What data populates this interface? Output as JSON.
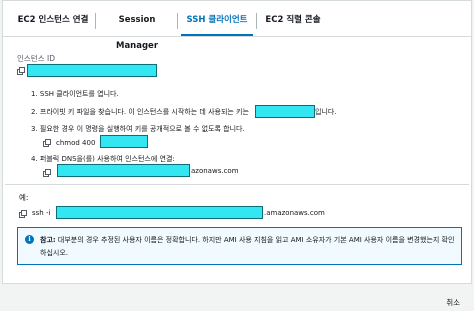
{
  "tabs": [
    {
      "label": "EC2 인스턴스 연결"
    },
    {
      "label": "Session Manager"
    },
    {
      "label": "SSH 클라이언트",
      "active": true
    },
    {
      "label": "EC2 직렬 콘솔"
    }
  ],
  "instance": {
    "label": "인스턴스 ID"
  },
  "steps": [
    {
      "num": "1.",
      "text": "SSH 클라이언트를 엽니다."
    },
    {
      "num": "2.",
      "text": "프라이빗 키 파일을 찾습니다. 이 인스턴스를 시작하는 데 사용되는 키는",
      "suffix": "입니다."
    },
    {
      "num": "3.",
      "text": "필요한 경우 이 명령을 실행하여 키를 공개적으로 볼 수 없도록 합니다."
    },
    {
      "num": "4.",
      "text": "퍼블릭 DNS을(를) 사용하여 인스턴스에 연결:"
    }
  ],
  "chmod_cmd": "chmod 400",
  "dns_suffix": "azonaws.com",
  "example": {
    "label": "예:",
    "cmd_prefix": "ssh -i",
    "cmd_suffix": ".amazonaws.com"
  },
  "alert": {
    "bold": "참고:",
    "text": " 대부분의 경우 추정된 사용자 이름은 정확합니다. 하지만 AMI 사용 지침을 읽고 AMI 소유자가 기본 AMI 사용자 이름을 변경했는지 확인하십시오.",
    "icon": "info-icon"
  },
  "footer": {
    "close_label": "취소"
  },
  "colors": {
    "accent": "#0073bb",
    "redaction": "#33e6f2"
  }
}
